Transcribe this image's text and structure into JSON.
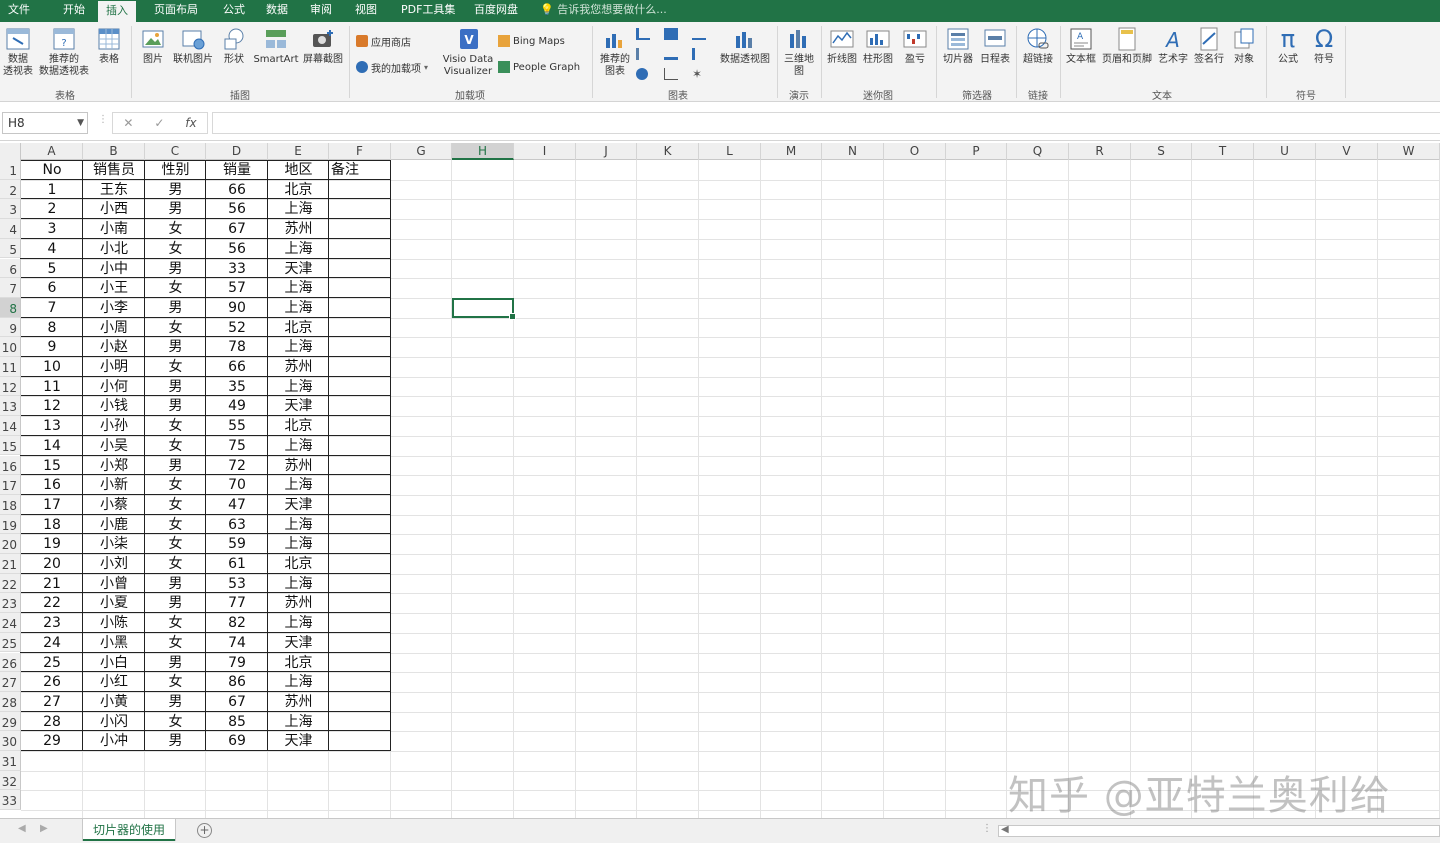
{
  "ribbon_tabs": [
    "文件",
    "开始",
    "插入",
    "页面布局",
    "公式",
    "数据",
    "审阅",
    "视图",
    "PDF工具集",
    "百度网盘"
  ],
  "active_tab": "插入",
  "tell_me": "告诉我您想要做什么...",
  "ribbon": {
    "pivot": "数据\n透视表",
    "recommended_pivot": "推荐的\n数据透视表",
    "table": "表格",
    "group_tables": "表格",
    "picture": "图片",
    "online_picture": "联机图片",
    "shapes": "形状",
    "smartart": "SmartArt",
    "screenshot": "屏幕截图",
    "group_illustrations": "插图",
    "app_store": "应用商店",
    "my_addins": "我的加载项",
    "visio": "Visio Data\nVisualizer",
    "bing_maps": "Bing Maps",
    "people_graph": "People Graph",
    "group_addins": "加载项",
    "recommended_charts": "推荐的\n图表",
    "pivot_chart": "数据透视图",
    "group_charts": "图表",
    "map3d": "三维地\n图",
    "group_tours": "演示",
    "sparkline_line": "折线图",
    "sparkline_column": "柱形图",
    "sparkline_winloss": "盈亏",
    "group_sparklines": "迷你图",
    "slicer": "切片器",
    "timeline": "日程表",
    "group_filters": "筛选器",
    "hyperlink": "超链接",
    "group_links": "链接",
    "textbox": "文本框",
    "header_footer": "页眉和页脚",
    "wordart": "艺术字",
    "signature": "签名行",
    "object": "对象",
    "group_text": "文本",
    "equation": "公式",
    "symbol": "符号",
    "group_symbols": "符号"
  },
  "formula_bar": {
    "name_box": "H8",
    "cancel": "✕",
    "enter": "✓",
    "fx": "fx",
    "content": ""
  },
  "columns": [
    "A",
    "B",
    "C",
    "D",
    "E",
    "F",
    "G",
    "H",
    "I",
    "J",
    "K",
    "L",
    "M",
    "N",
    "O",
    "P",
    "Q",
    "R",
    "S",
    "T",
    "U",
    "V",
    "W"
  ],
  "selected_column": "H",
  "selected_row": 8,
  "row_numbers": [
    1,
    2,
    3,
    4,
    5,
    6,
    7,
    8,
    9,
    10,
    11,
    12,
    13,
    14,
    15,
    16,
    17,
    18,
    19,
    20,
    21,
    22,
    23,
    24,
    25,
    26,
    27,
    28,
    29,
    30,
    31,
    32,
    33
  ],
  "table": {
    "headers": [
      "No",
      "销售员",
      "性别",
      "销量",
      "地区",
      "备注"
    ],
    "rows": [
      [
        "1",
        "王东",
        "男",
        "66",
        "北京",
        ""
      ],
      [
        "2",
        "小西",
        "男",
        "56",
        "上海",
        ""
      ],
      [
        "3",
        "小南",
        "女",
        "67",
        "苏州",
        ""
      ],
      [
        "4",
        "小北",
        "女",
        "56",
        "上海",
        ""
      ],
      [
        "5",
        "小中",
        "男",
        "33",
        "天津",
        ""
      ],
      [
        "6",
        "小王",
        "女",
        "57",
        "上海",
        ""
      ],
      [
        "7",
        "小李",
        "男",
        "90",
        "上海",
        ""
      ],
      [
        "8",
        "小周",
        "女",
        "52",
        "北京",
        ""
      ],
      [
        "9",
        "小赵",
        "男",
        "78",
        "上海",
        ""
      ],
      [
        "10",
        "小明",
        "女",
        "66",
        "苏州",
        ""
      ],
      [
        "11",
        "小何",
        "男",
        "35",
        "上海",
        ""
      ],
      [
        "12",
        "小钱",
        "男",
        "49",
        "天津",
        ""
      ],
      [
        "13",
        "小孙",
        "女",
        "55",
        "北京",
        ""
      ],
      [
        "14",
        "小吴",
        "女",
        "75",
        "上海",
        ""
      ],
      [
        "15",
        "小郑",
        "男",
        "72",
        "苏州",
        ""
      ],
      [
        "16",
        "小新",
        "女",
        "70",
        "上海",
        ""
      ],
      [
        "17",
        "小蔡",
        "女",
        "47",
        "天津",
        ""
      ],
      [
        "18",
        "小鹿",
        "女",
        "63",
        "上海",
        ""
      ],
      [
        "19",
        "小柒",
        "女",
        "59",
        "上海",
        ""
      ],
      [
        "20",
        "小刘",
        "女",
        "61",
        "北京",
        ""
      ],
      [
        "21",
        "小曾",
        "男",
        "53",
        "上海",
        ""
      ],
      [
        "22",
        "小夏",
        "男",
        "77",
        "苏州",
        ""
      ],
      [
        "23",
        "小陈",
        "女",
        "82",
        "上海",
        ""
      ],
      [
        "24",
        "小黑",
        "女",
        "74",
        "天津",
        ""
      ],
      [
        "25",
        "小白",
        "男",
        "79",
        "北京",
        ""
      ],
      [
        "26",
        "小红",
        "女",
        "86",
        "上海",
        ""
      ],
      [
        "27",
        "小黄",
        "男",
        "67",
        "苏州",
        ""
      ],
      [
        "28",
        "小闪",
        "女",
        "85",
        "上海",
        ""
      ],
      [
        "29",
        "小冲",
        "男",
        "69",
        "天津",
        ""
      ]
    ]
  },
  "sheet_tab": "切片器的使用",
  "watermark": "知乎 @亚特兰奥利给",
  "accent_color": "#217346"
}
